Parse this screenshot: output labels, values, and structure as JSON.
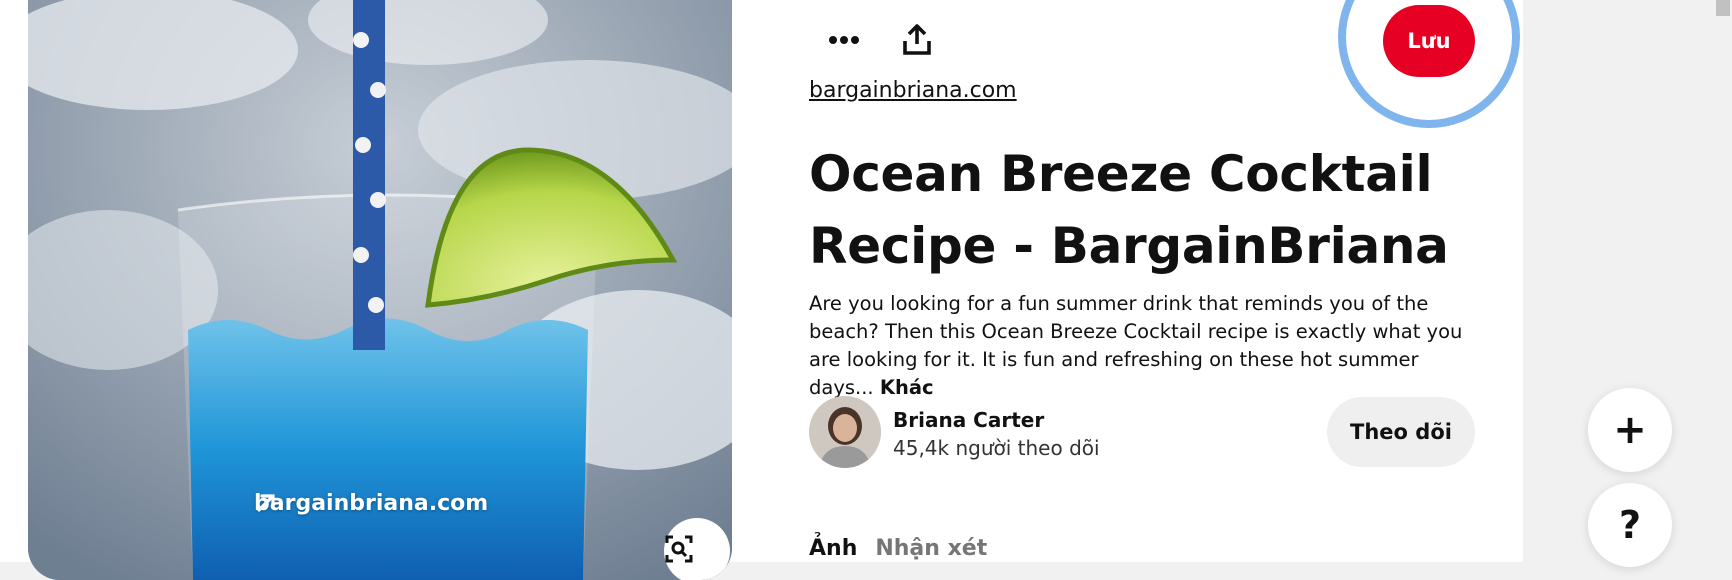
{
  "pin": {
    "image_alt": "Blue cocktail with lime wedge and polka-dot straw",
    "overlay_source": "bargainbriana.com",
    "source_link": "bargainbriana.com",
    "title": "Ocean Breeze Cocktail Recipe - BargainBriana",
    "description": "Are you looking for a fun summer drink that reminds you of the beach? Then this Ocean Breeze Cocktail recipe is exactly what you are looking for it. It is fun and refreshing on these hot summer days...",
    "more_label": "Khác"
  },
  "toolbar": {
    "more_icon": "more-horizontal-icon",
    "share_icon": "share-upload-icon",
    "save_label": "Lưu"
  },
  "author": {
    "name": "Briana Carter",
    "followers": "45,4k người theo dõi",
    "follow_label": "Theo dõi"
  },
  "tabs": [
    {
      "label": "Ảnh",
      "active": true
    },
    {
      "label": "Nhận xét",
      "active": false
    }
  ],
  "floating": {
    "add_label": "+",
    "help_label": "?"
  },
  "colors": {
    "save_red": "#e60023",
    "focus_ring": "#7fb4ec",
    "follow_bg": "#efefef"
  }
}
